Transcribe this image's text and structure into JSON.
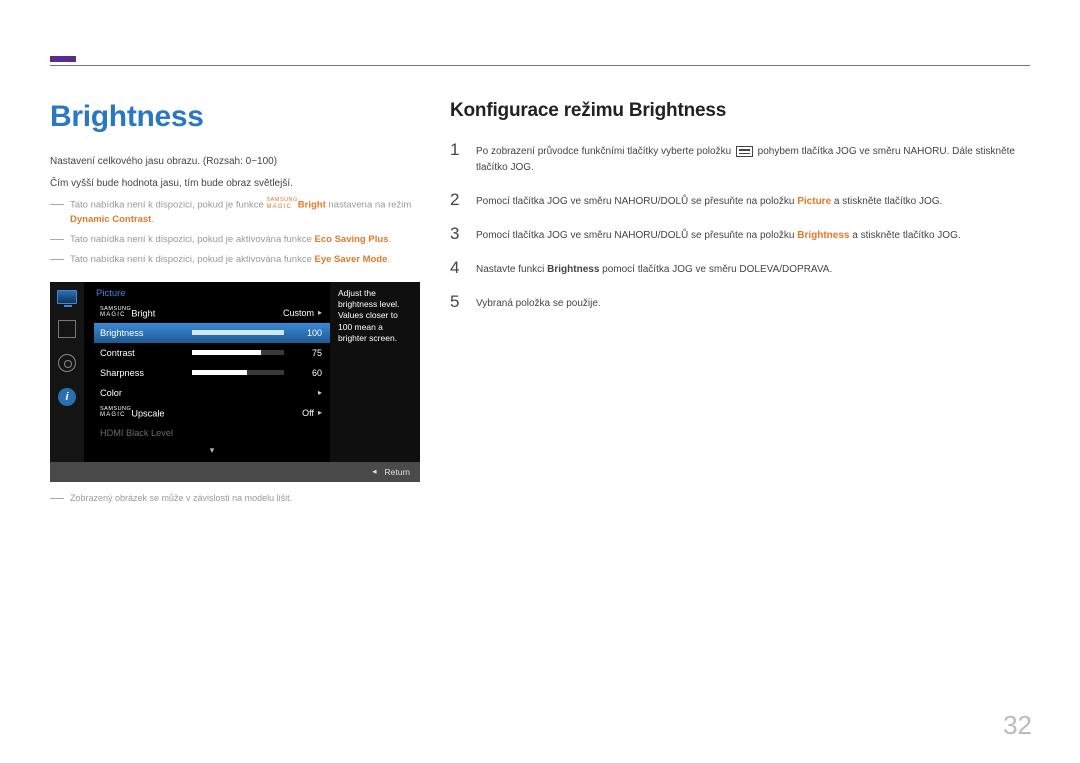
{
  "left": {
    "title": "Brightness",
    "line1": "Nastavení celkového jasu obrazu. (Rozsah: 0~100)",
    "line2": "Čím vyšší bude hodnota jasu, tím bude obraz světlejší.",
    "note1_pre": "Tato nabídka není k dispozici, pokud je funkce ",
    "note1_magic_top": "SAMSUNG",
    "note1_magic_bot": "MAGIC",
    "note1_bright": "Bright",
    "note1_mid": " nastavena na režim ",
    "note1_mode": "Dynamic Contrast",
    "note2_pre": "Tato nabídka není k dispozici, pokud je aktivována funkce ",
    "note2_mode": "Eco Saving Plus",
    "note3_pre": "Tato nabídka není k dispozici, pokud je aktivována funkce ",
    "note3_mode": "Eye Saver Mode",
    "caption": "Zobrazený obrázek se může v závislosti na modelu lišit."
  },
  "osd": {
    "menu": "Picture",
    "magic_top": "SAMSUNG",
    "magic_bot": "MAGIC",
    "row1_suffix": "Bright",
    "row1_val": "Custom",
    "row2_label": "Brightness",
    "row2_val": "100",
    "row3_label": "Contrast",
    "row3_val": "75",
    "row4_label": "Sharpness",
    "row4_val": "60",
    "row5_label": "Color",
    "row6_suffix": "Upscale",
    "row6_val": "Off",
    "row7_label": "HDMI Black Level",
    "tip": "Adjust the brightness level. Values closer to 100 mean a brighter screen.",
    "footer_ret": "Return",
    "footer_arrow": "◂"
  },
  "right": {
    "title": "Konfigurace režimu Brightness",
    "s1a": "Po zobrazení průvodce funkčními tlačítky vyberte položku ",
    "s1b": " pohybem tlačítka JOG ve směru NAHORU. Dále stiskněte tlačítko JOG.",
    "s2a": "Pomocí tlačítka JOG ve směru NAHORU/DOLŮ se přesuňte na položku ",
    "s2mode": "Picture",
    "s2b": " a stiskněte tlačítko JOG.",
    "s3a": "Pomocí tlačítka JOG ve směru NAHORU/DOLŮ se přesuňte na položku ",
    "s3mode": "Brightness",
    "s3b": " a stiskněte tlačítko JOG.",
    "s4a": "Nastavte funkci ",
    "s4mode": "Brightness",
    "s4b": " pomocí tlačítka JOG ve směru DOLEVA/DOPRAVA.",
    "s5": "Vybraná položka se použije."
  },
  "page": "32"
}
